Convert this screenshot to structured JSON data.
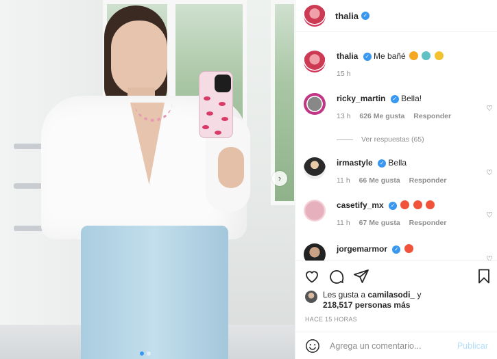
{
  "post": {
    "photo_alt": "photo",
    "carousel": {
      "total": 2,
      "active": 1
    },
    "header": {
      "username": "thalia",
      "verified": true
    },
    "caption": {
      "username": "thalia",
      "text": "Me bañé",
      "time": "15 h"
    },
    "comments": [
      {
        "username": "ricky_martin",
        "text": "Bella!",
        "time": "13 h",
        "likes": "626 Me gusta",
        "reply": "Responder",
        "view_replies": "Ver respuestas (65)"
      },
      {
        "username": "irmastyle",
        "text": "Bella",
        "time": "11 h",
        "likes": "66 Me gusta",
        "reply": "Responder"
      },
      {
        "username": "casetify_mx",
        "text": "",
        "time": "11 h",
        "likes": "67 Me gusta",
        "reply": "Responder"
      },
      {
        "username": "jorgemarmor",
        "text": ""
      }
    ],
    "likes": {
      "prefix": "Les gusta a",
      "user": "camilasodi_",
      "joiner": "y",
      "count": "218,517 personas más"
    },
    "timestamp": "HACE 15 HORAS",
    "composer": {
      "placeholder": "Agrega un comentario...",
      "post_label": "Publicar"
    }
  },
  "icons": {
    "like": "heart-icon",
    "comment": "comment-icon",
    "share": "share-icon",
    "save": "bookmark-icon",
    "emoji": "smile-icon",
    "next": "chevron-right-icon"
  },
  "colors": {
    "verified": "#3897f0",
    "link_disabled": "#b2dffc",
    "meta": "#8e8e8e"
  }
}
